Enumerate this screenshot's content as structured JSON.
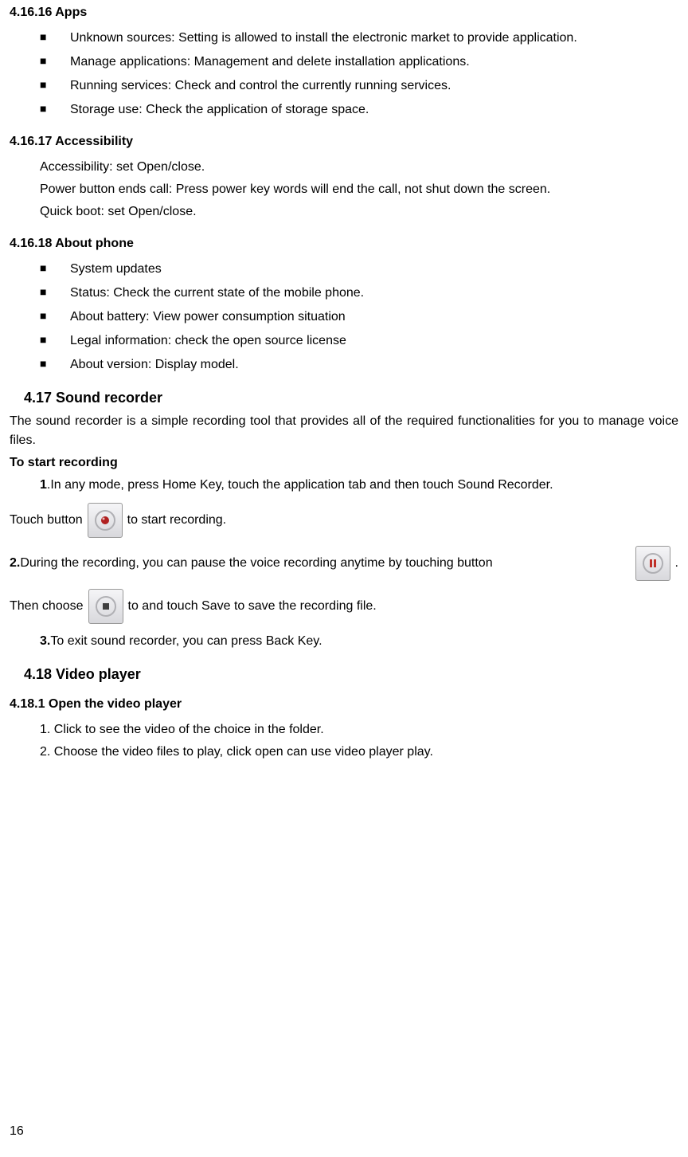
{
  "s4_16_16": {
    "heading": "4.16.16  Apps",
    "items": [
      "Unknown sources: Setting is allowed to install the electronic market to provide application.",
      "Manage applications: Management and delete installation applications.",
      "Running services: Check and control the currently running services.",
      "Storage use: Check the application of storage space."
    ]
  },
  "s4_16_17": {
    "heading": "4.16.17  Accessibility",
    "p1": "Accessibility: set Open/close.",
    "p2": "Power button ends call: Press power key words will end the call, not shut down the screen.",
    "p3": "Quick boot: set Open/close."
  },
  "s4_16_18": {
    "heading": "4.16.18 About phone",
    "items": [
      "System updates",
      "Status: Check the current state of the mobile phone.",
      "About battery: View power consumption situation",
      "Legal information: check the open source license",
      "About version: Display model."
    ]
  },
  "s4_17": {
    "heading": "4.17  Sound recorder",
    "intro": "The sound recorder is a simple recording tool that provides all of the required functionalities for you to manage voice files.",
    "to_start": "To start recording",
    "step1_bold": "1",
    "step1": ".In any mode, press Home Key, touch the application tab and then touch Sound Recorder.",
    "touch_prefix": "Touch button ",
    "touch_suffix": "  to start recording.",
    "step2_bold": "2.",
    "step2_a": "During the recording, you can pause the voice recording anytime by touching button",
    "step2_end": ".",
    "then_prefix": "Then choose ",
    "then_suffix": "  to and touch Save to save the recording file.",
    "step3_bold": "3.",
    "step3": "To exit sound recorder, you can press Back Key."
  },
  "s4_18": {
    "heading": "4.18  Video player"
  },
  "s4_18_1": {
    "heading": "4.18.1  Open the video player",
    "p1": "1. Click to see the video of the choice in the folder.",
    "p2": "2. Choose the video files to play, click open can use video player play."
  },
  "page_number": "16"
}
